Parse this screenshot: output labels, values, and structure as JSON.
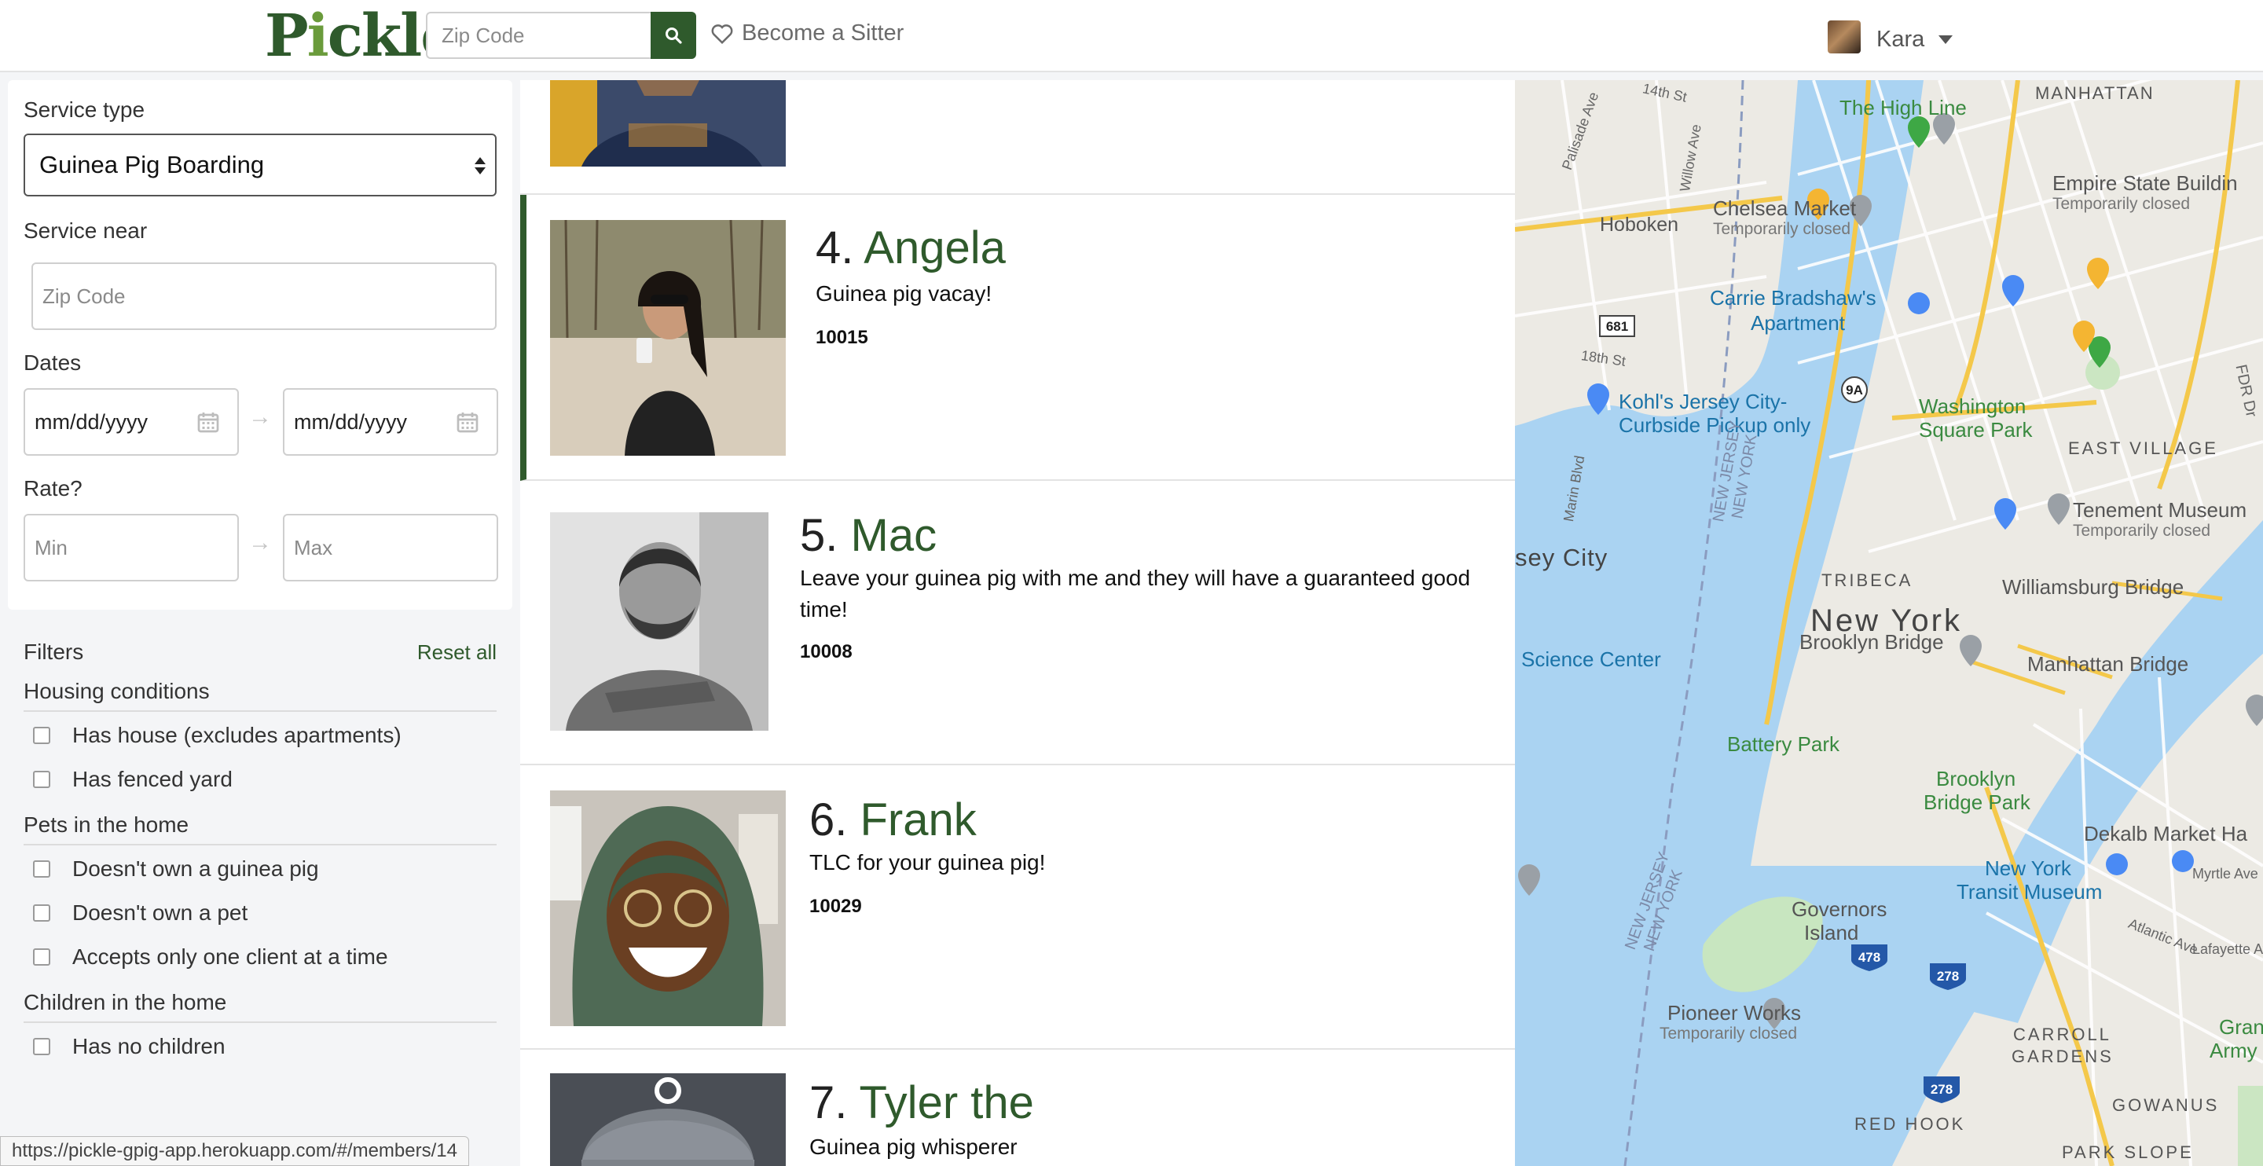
{
  "header": {
    "logo": "Pickle",
    "zip_placeholder": "Zip Code",
    "become_sitter": "Become a Sitter",
    "user_name": "Kara"
  },
  "sidebar": {
    "service_type_label": "Service type",
    "service_type_value": "Guinea Pig Boarding",
    "service_near_label": "Service near",
    "service_near_placeholder": "Zip Code",
    "dates_label": "Dates",
    "date_start": "mm/dd/yyyy",
    "date_end": "mm/dd/yyyy",
    "rate_label": "Rate?",
    "rate_min_placeholder": "Min",
    "rate_max_placeholder": "Max",
    "filters_label": "Filters",
    "reset_label": "Reset all",
    "groups": [
      {
        "title": "Housing conditions",
        "options": [
          "Has house (excludes apartments)",
          "Has fenced yard"
        ]
      },
      {
        "title": "Pets in the home",
        "options": [
          "Doesn't own a guinea pig",
          "Doesn't own a pet",
          "Accepts only one client at a time"
        ]
      },
      {
        "title": "Children in the home",
        "options": [
          "Has no children"
        ]
      }
    ]
  },
  "sitters": [
    {
      "num": "4.",
      "name": "Angela",
      "desc": "Guinea pig vacay!",
      "zip": "10015"
    },
    {
      "num": "5.",
      "name": "Mac",
      "desc": "Leave your guinea pig with me and they will have a guaranteed good time!",
      "zip": "10008"
    },
    {
      "num": "6.",
      "name": "Frank",
      "desc": "TLC for your guinea pig!",
      "zip": "10029"
    },
    {
      "num": "7.",
      "name": "Tyler the",
      "desc": "Guinea pig whisperer",
      "zip": ""
    }
  ],
  "map": {
    "labels": {
      "high_line": "The High Line",
      "manhattan_top": "MANHATTAN",
      "empire": "Empire State Buildin",
      "temp_closed": "Temporarily closed",
      "chelsea": "Chelsea Market",
      "hoboken": "Hoboken",
      "carrie1": "Carrie Bradshaw's",
      "carrie2": "Apartment",
      "kohls1": "Kohl's Jersey City-",
      "kohls2": "Curbside Pickup only",
      "wash1": "Washington",
      "wash2": "Square Park",
      "east_village": "EAST VILLAGE",
      "tenement": "Tenement Museum",
      "jersey_city": "sey City",
      "tribeca": "TRIBECA",
      "williamsburg": "Williamsburg Bridge",
      "new_york": "New York",
      "science": "Science Center",
      "brooklyn_bridge": "Brooklyn Bridge",
      "manhattan_bridge": "Manhattan Bridge",
      "battery": "Battery Park",
      "bb_park1": "Brooklyn",
      "bb_park2": "Bridge Park",
      "dekalb": "Dekalb Market Ha",
      "ny_transit1": "New York",
      "ny_transit2": "Transit Museum",
      "governors1": "Governors",
      "governors2": "Island",
      "pioneer": "Pioneer Works",
      "carroll1": "CARROLL",
      "carroll2": "GARDENS",
      "gowanus": "GOWANUS",
      "red_hook": "RED HOOK",
      "park_slope": "PARK SLOPE",
      "gran1": "Gran",
      "gran2": "Army P",
      "nj_ny": "NEW JERSEY",
      "nj_ny2": "NEW YORK",
      "st_14": "14th St",
      "st_18": "18th St",
      "willow": "Willow Ave",
      "palisade": "Palisade Ave",
      "marin": "Marin Blvd",
      "fdr": "FDR Dr",
      "atlantic": "Atlantic Ave",
      "myrtle": "Myrtle Ave",
      "lafayette": "Lafayette Ave",
      "route_681": "681",
      "route_9a": "9A",
      "route_478": "478",
      "route_278a": "278",
      "route_278b": "278"
    }
  },
  "status_url": "https://pickle-gpig-app.herokuapp.com/#/members/14"
}
